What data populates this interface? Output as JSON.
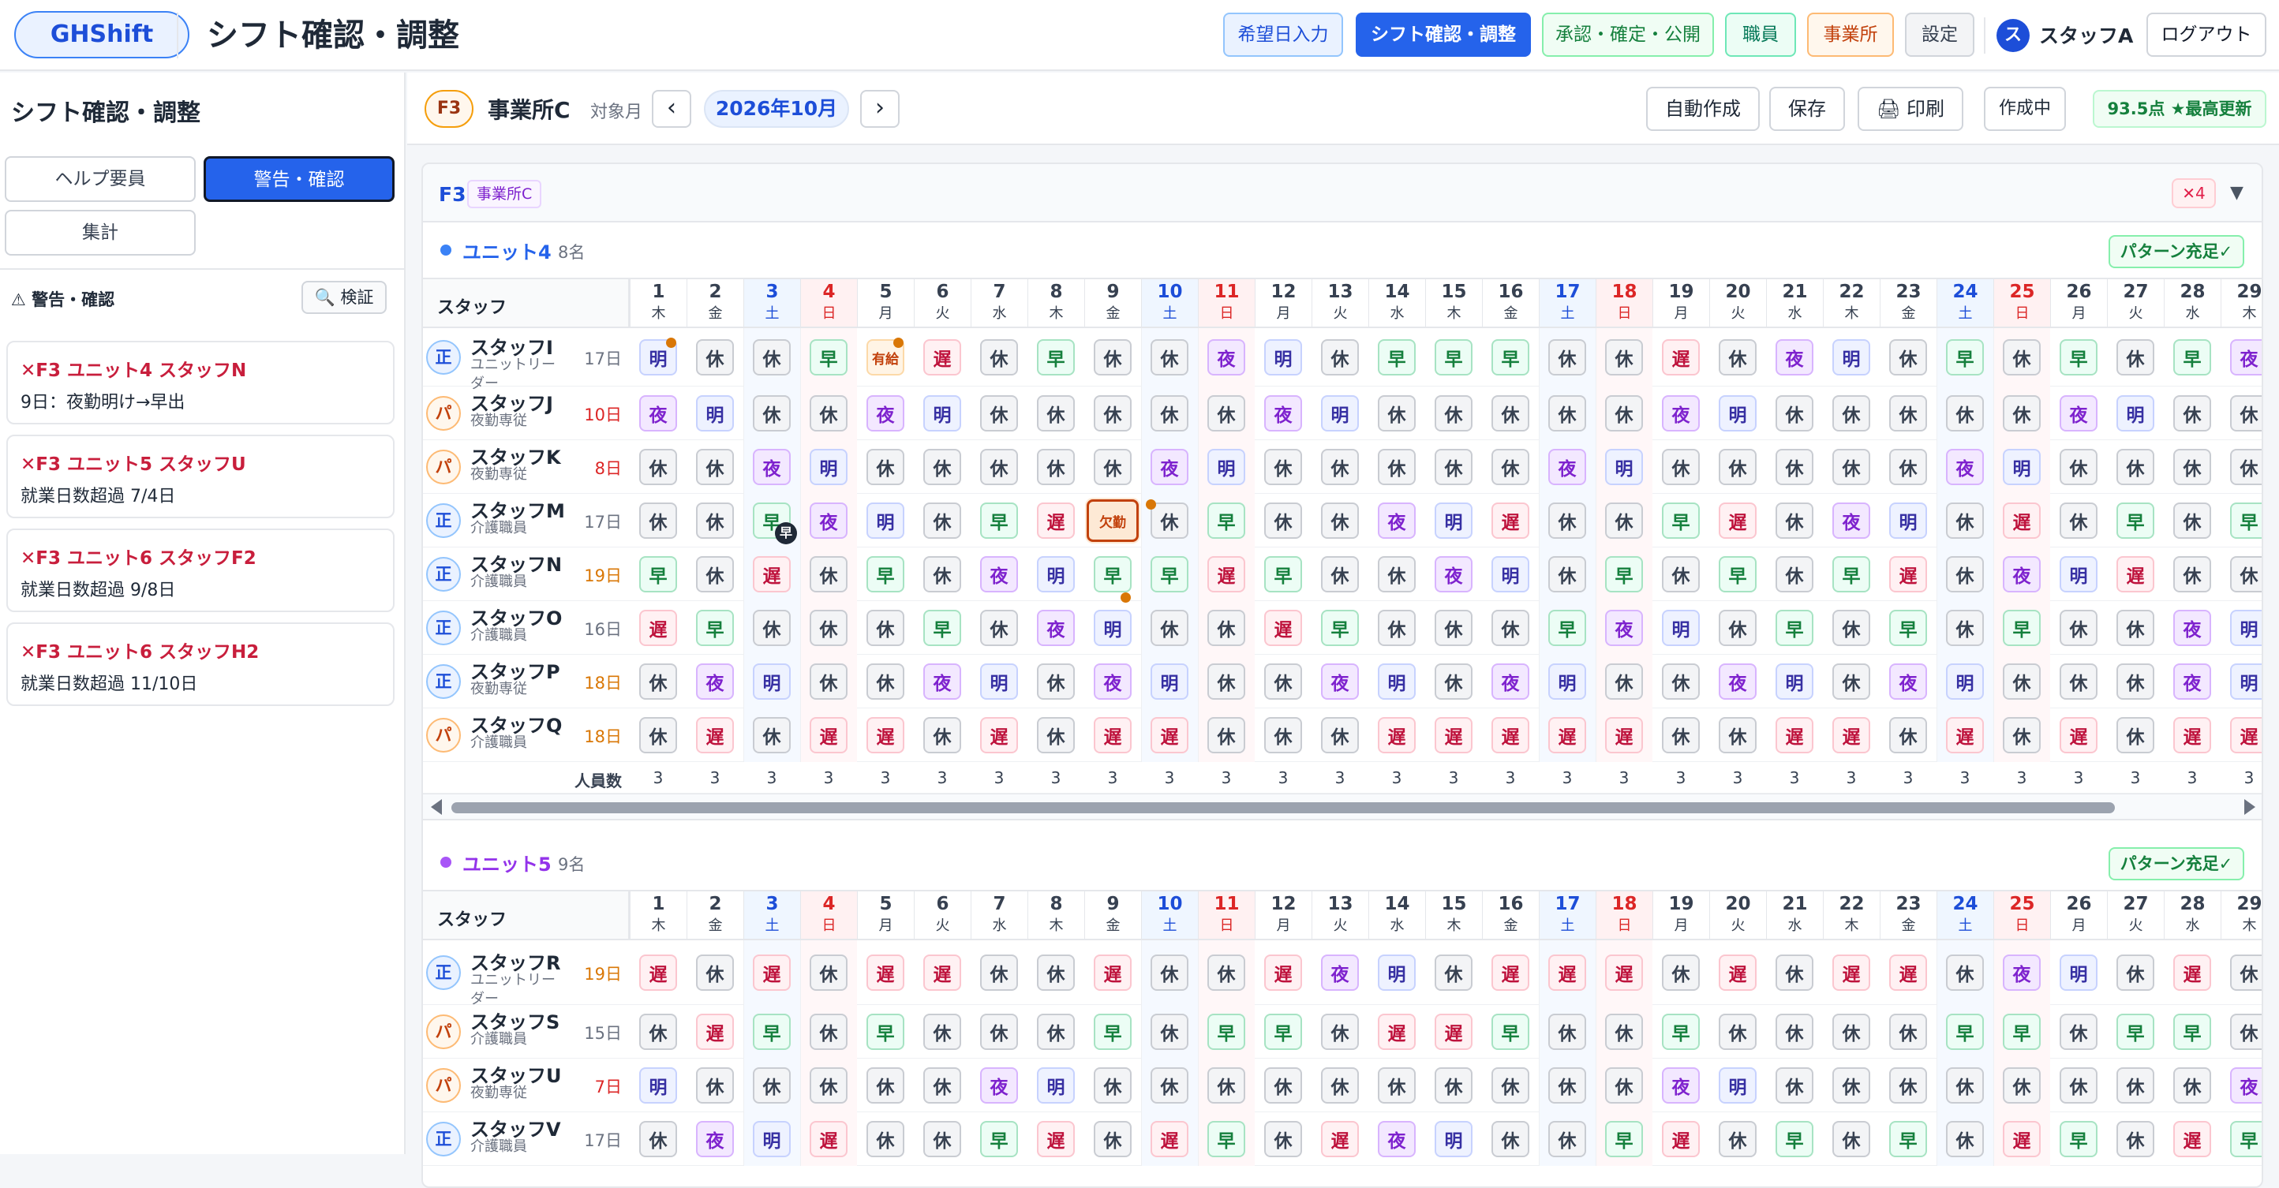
{
  "app": {
    "logo": "GHShift",
    "title": "シフト確認・調整"
  },
  "nav": [
    {
      "label": "希望日入力",
      "bg": "#eaf2ff",
      "border": "#93c5fd",
      "color": "#1d4ed8"
    },
    {
      "label": "シフト確認・調整",
      "bg": "#2563eb",
      "border": "#2563eb",
      "color": "#ffffff",
      "active": true
    },
    {
      "label": "承認・確定・公開",
      "bg": "#f0fdf4",
      "border": "#86efac",
      "color": "#15803d"
    },
    {
      "label": "職員",
      "bg": "#ecfdf5",
      "border": "#6ee7b7",
      "color": "#047857"
    },
    {
      "label": "事業所",
      "bg": "#fff7ed",
      "border": "#fdba74",
      "color": "#c2410c"
    },
    {
      "label": "設定",
      "bg": "#f3f4f6",
      "border": "#d1d5db",
      "color": "#374151"
    }
  ],
  "user": {
    "avatar": "ス",
    "name": "スタッフA",
    "logout": "ログアウト"
  },
  "sidebar": {
    "title": "シフト確認・調整",
    "tabs": {
      "help": "ヘルプ要員",
      "warn": "警告・確認",
      "summary": "集計"
    },
    "warn_title": "⚠ 警告・確認",
    "verify": "検証",
    "warnings": [
      {
        "title": "✕F3 ユニット4 スタッフN",
        "detail": "9日：夜勤明け→早出"
      },
      {
        "title": "✕F3 ユニット5 スタッフU",
        "detail": "就業日数超過 7/4日"
      },
      {
        "title": "✕F3 ユニット6 スタッフF2",
        "detail": "就業日数超過 9/8日"
      },
      {
        "title": "✕F3 ユニット6 スタッフH2",
        "detail": "就業日数超過 11/10日"
      }
    ]
  },
  "toolbar": {
    "facility_code": "F3",
    "facility_name": "事業所C",
    "month_label": "対象月",
    "prev": "‹",
    "month": "2026年10月",
    "next": "›",
    "auto": "自動作成",
    "save": "保存",
    "print": "印刷",
    "status": "作成中",
    "score": "93.5点 ★最高更新"
  },
  "panel": {
    "code": "F3",
    "facility": "事業所C",
    "warn_count": "✕4",
    "collapse": "▼"
  },
  "staff_header": "スタッフ",
  "count_label": "人員数",
  "days": [
    {
      "n": "1",
      "w": "木",
      "t": ""
    },
    {
      "n": "2",
      "w": "金",
      "t": ""
    },
    {
      "n": "3",
      "w": "土",
      "t": "sat"
    },
    {
      "n": "4",
      "w": "日",
      "t": "sun"
    },
    {
      "n": "5",
      "w": "月",
      "t": ""
    },
    {
      "n": "6",
      "w": "火",
      "t": ""
    },
    {
      "n": "7",
      "w": "水",
      "t": ""
    },
    {
      "n": "8",
      "w": "木",
      "t": ""
    },
    {
      "n": "9",
      "w": "金",
      "t": ""
    },
    {
      "n": "10",
      "w": "土",
      "t": "sat"
    },
    {
      "n": "11",
      "w": "日",
      "t": "sun"
    },
    {
      "n": "12",
      "w": "月",
      "t": ""
    },
    {
      "n": "13",
      "w": "火",
      "t": ""
    },
    {
      "n": "14",
      "w": "水",
      "t": ""
    },
    {
      "n": "15",
      "w": "木",
      "t": ""
    },
    {
      "n": "16",
      "w": "金",
      "t": ""
    },
    {
      "n": "17",
      "w": "土",
      "t": "sat"
    },
    {
      "n": "18",
      "w": "日",
      "t": "sun"
    },
    {
      "n": "19",
      "w": "月",
      "t": ""
    },
    {
      "n": "20",
      "w": "火",
      "t": ""
    },
    {
      "n": "21",
      "w": "水",
      "t": ""
    },
    {
      "n": "22",
      "w": "木",
      "t": ""
    },
    {
      "n": "23",
      "w": "金",
      "t": ""
    },
    {
      "n": "24",
      "w": "土",
      "t": "sat"
    },
    {
      "n": "25",
      "w": "日",
      "t": "sun"
    },
    {
      "n": "26",
      "w": "月",
      "t": ""
    },
    {
      "n": "27",
      "w": "火",
      "t": ""
    },
    {
      "n": "28",
      "w": "水",
      "t": ""
    },
    {
      "n": "29",
      "w": "木",
      "t": ""
    }
  ],
  "units": [
    {
      "name": "ユニット4",
      "count": "8名",
      "dot": "#3b82f6",
      "name_color": "#2563eb",
      "pattern": "パターン充足✓",
      "staff": [
        {
          "type": "正",
          "name": "スタッフI",
          "role": "ユニットリーダー",
          "days": "17日",
          "days_color": "#6b7280",
          "shifts": [
            "明",
            "休",
            "休",
            "早",
            "有給",
            "遅",
            "休",
            "早",
            "休",
            "休",
            "夜",
            "明",
            "休",
            "早",
            "早",
            "早",
            "休",
            "休",
            "遅",
            "休",
            "夜",
            "明",
            "休",
            "早",
            "休",
            "早",
            "休",
            "早",
            "夜"
          ]
        },
        {
          "type": "パ",
          "name": "スタッフJ",
          "role": "夜勤専従",
          "days": "10日",
          "days_color": "#dc2626",
          "shifts": [
            "夜",
            "明",
            "休",
            "休",
            "夜",
            "明",
            "休",
            "休",
            "休",
            "休",
            "休",
            "夜",
            "明",
            "休",
            "休",
            "休",
            "休",
            "休",
            "夜",
            "明",
            "休",
            "休",
            "休",
            "休",
            "休",
            "夜",
            "明",
            "休",
            "休"
          ]
        },
        {
          "type": "パ",
          "name": "スタッフK",
          "role": "夜勤専従",
          "days": "8日",
          "days_color": "#dc2626",
          "shifts": [
            "休",
            "休",
            "夜",
            "明",
            "休",
            "休",
            "休",
            "休",
            "休",
            "夜",
            "明",
            "休",
            "休",
            "休",
            "休",
            "休",
            "夜",
            "明",
            "休",
            "休",
            "休",
            "休",
            "休",
            "夜",
            "明",
            "休",
            "休",
            "休",
            "休"
          ]
        },
        {
          "type": "正",
          "name": "スタッフM",
          "role": "介護職員",
          "days": "17日",
          "days_color": "#6b7280",
          "shifts": [
            "休",
            "休",
            "早",
            "夜",
            "明",
            "休",
            "早",
            "遅",
            "欠勤",
            "休",
            "早",
            "休",
            "休",
            "夜",
            "明",
            "遅",
            "休",
            "休",
            "早",
            "遅",
            "休",
            "夜",
            "明",
            "休",
            "遅",
            "休",
            "早",
            "休",
            "早"
          ]
        },
        {
          "type": "正",
          "name": "スタッフN",
          "role": "介護職員",
          "days": "19日",
          "days_color": "#d97706",
          "shifts": [
            "早",
            "休",
            "遅",
            "休",
            "早",
            "休",
            "夜",
            "明",
            "早",
            "早",
            "遅",
            "早",
            "休",
            "休",
            "夜",
            "明",
            "休",
            "早",
            "休",
            "早",
            "休",
            "早",
            "遅",
            "休",
            "夜",
            "明",
            "遅",
            "休",
            "休"
          ]
        },
        {
          "type": "正",
          "name": "スタッフO",
          "role": "介護職員",
          "days": "16日",
          "days_color": "#6b7280",
          "shifts": [
            "遅",
            "早",
            "休",
            "休",
            "休",
            "早",
            "休",
            "夜",
            "明",
            "休",
            "休",
            "遅",
            "早",
            "休",
            "休",
            "休",
            "早",
            "夜",
            "明",
            "休",
            "早",
            "休",
            "早",
            "休",
            "早",
            "休",
            "休",
            "夜",
            "明"
          ]
        },
        {
          "type": "正",
          "name": "スタッフP",
          "role": "夜勤専従",
          "days": "18日",
          "days_color": "#d97706",
          "shifts": [
            "休",
            "夜",
            "明",
            "休",
            "休",
            "夜",
            "明",
            "休",
            "夜",
            "明",
            "休",
            "休",
            "夜",
            "明",
            "休",
            "夜",
            "明",
            "休",
            "休",
            "夜",
            "明",
            "休",
            "夜",
            "明",
            "休",
            "休",
            "休",
            "夜",
            "明"
          ]
        },
        {
          "type": "パ",
          "name": "スタッフQ",
          "role": "介護職員",
          "days": "18日",
          "days_color": "#d97706",
          "shifts": [
            "休",
            "遅",
            "休",
            "遅",
            "遅",
            "休",
            "遅",
            "休",
            "遅",
            "遅",
            "休",
            "休",
            "休",
            "遅",
            "遅",
            "遅",
            "遅",
            "遅",
            "休",
            "休",
            "遅",
            "遅",
            "休",
            "遅",
            "休",
            "遅",
            "休",
            "遅",
            "遅"
          ]
        }
      ],
      "counts": [
        "3",
        "3",
        "3",
        "3",
        "3",
        "3",
        "3",
        "3",
        "3",
        "3",
        "3",
        "3",
        "3",
        "3",
        "3",
        "3",
        "3",
        "3",
        "3",
        "3",
        "3",
        "3",
        "3",
        "3",
        "3",
        "3",
        "3",
        "3",
        "3"
      ]
    },
    {
      "name": "ユニット5",
      "count": "9名",
      "dot": "#a855f7",
      "name_color": "#9333ea",
      "pattern": "パターン充足✓",
      "staff": [
        {
          "type": "正",
          "name": "スタッフR",
          "role": "ユニットリーダー",
          "days": "19日",
          "days_color": "#d97706",
          "shifts": [
            "遅",
            "休",
            "遅",
            "休",
            "遅",
            "遅",
            "休",
            "休",
            "遅",
            "休",
            "休",
            "遅",
            "夜",
            "明",
            "休",
            "遅",
            "遅",
            "遅",
            "休",
            "遅",
            "休",
            "遅",
            "遅",
            "休",
            "夜",
            "明",
            "休",
            "遅",
            "休"
          ]
        },
        {
          "type": "パ",
          "name": "スタッフS",
          "role": "介護職員",
          "days": "15日",
          "days_color": "#6b7280",
          "shifts": [
            "休",
            "遅",
            "早",
            "休",
            "早",
            "休",
            "休",
            "休",
            "早",
            "休",
            "早",
            "早",
            "休",
            "遅",
            "遅",
            "早",
            "休",
            "休",
            "早",
            "休",
            "休",
            "休",
            "休",
            "早",
            "早",
            "休",
            "早",
            "早",
            "休"
          ]
        },
        {
          "type": "パ",
          "name": "スタッフU",
          "role": "夜勤専従",
          "days": "7日",
          "days_color": "#dc2626",
          "shifts": [
            "明",
            "休",
            "休",
            "休",
            "休",
            "休",
            "夜",
            "明",
            "休",
            "休",
            "休",
            "休",
            "休",
            "休",
            "休",
            "休",
            "休",
            "休",
            "夜",
            "明",
            "休",
            "休",
            "休",
            "休",
            "休",
            "休",
            "休",
            "休",
            "夜"
          ]
        },
        {
          "type": "正",
          "name": "スタッフV",
          "role": "介護職員",
          "days": "17日",
          "days_color": "#6b7280",
          "shifts": [
            "休",
            "夜",
            "明",
            "遅",
            "休",
            "休",
            "早",
            "遅",
            "休",
            "遅",
            "早",
            "休",
            "遅",
            "夜",
            "明",
            "休",
            "休",
            "早",
            "遅",
            "休",
            "早",
            "休",
            "早",
            "休",
            "遅",
            "早",
            "休",
            "遅",
            "早"
          ]
        }
      ]
    }
  ]
}
